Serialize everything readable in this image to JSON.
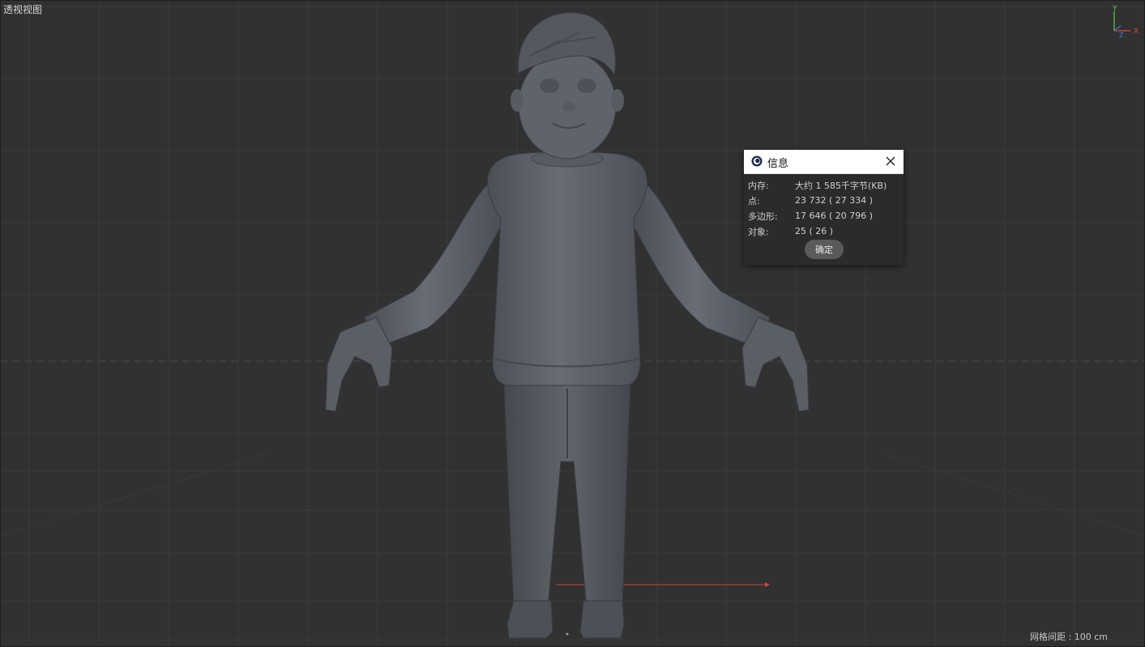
{
  "viewport": {
    "title": "透视视图",
    "grid_spacing": "网格间距 : 100 cm",
    "axis": {
      "y": "Y",
      "x": "X",
      "z": "Z"
    }
  },
  "info_dialog": {
    "title": "信息",
    "icon": "cinema4d-icon",
    "rows": [
      {
        "label": "内存:",
        "value": "大约 1 585千字节(KB)"
      },
      {
        "label": "点:",
        "value": "23 732 ( 27 334 )"
      },
      {
        "label": "多边形:",
        "value": "17 646 ( 20 796 )"
      },
      {
        "label": "对象:",
        "value": "25 ( 26 )"
      }
    ],
    "ok_label": "确定"
  },
  "colors": {
    "background": "#313131",
    "grid": "#3a3a3a",
    "model": "#5c6068",
    "axis_x": "#e0453c",
    "axis_y": "#6cc84a",
    "axis_z": "#3f7fd8"
  }
}
